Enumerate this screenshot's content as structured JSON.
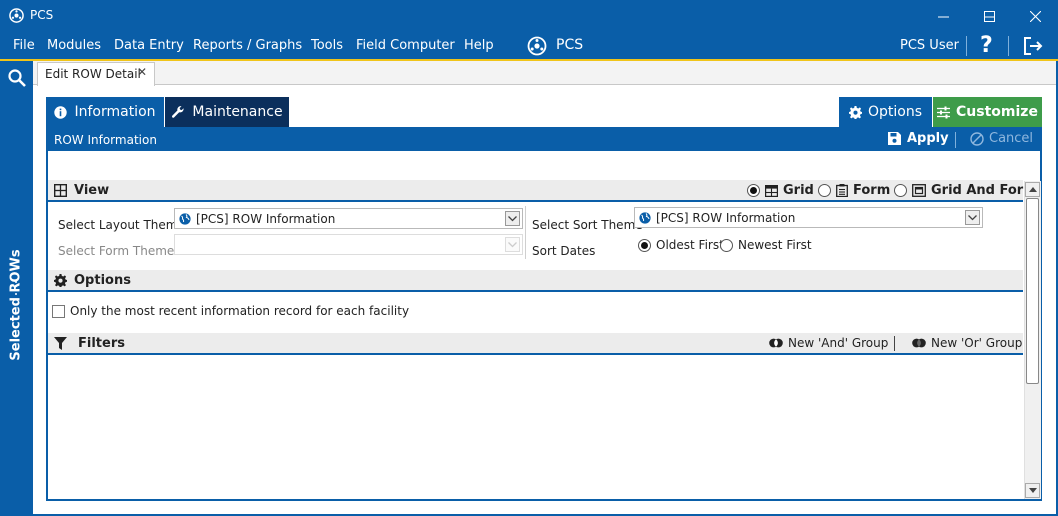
{
  "window": {
    "title": "PCS"
  },
  "menu": {
    "items": [
      "File",
      "Modules",
      "Data Entry",
      "Reports / Graphs",
      "Tools",
      "Field Computer",
      "Help"
    ],
    "brand": "PCS",
    "user": "PCS User",
    "help_glyph": "?"
  },
  "rail": {
    "label": "Selected ROWs"
  },
  "doc_tab": {
    "label": "Edit ROW Detail",
    "close_glyph": "✕"
  },
  "tabs": {
    "information": "Information",
    "maintenance": "Maintenance"
  },
  "buttons": {
    "options": "Options",
    "customize": "Customize",
    "apply": "Apply",
    "cancel": "Cancel"
  },
  "infobar": {
    "title": "ROW Information"
  },
  "view": {
    "title": "View",
    "modes": [
      "Grid",
      "Form",
      "Grid And Form"
    ],
    "selected_mode": "Grid",
    "layout_theme_label": "Select Layout Theme",
    "layout_theme_value": "[PCS] ROW Information",
    "form_theme_label": "Select Form Theme",
    "form_theme_value": "",
    "sort_theme_label": "Select Sort Theme",
    "sort_theme_value": "[PCS] ROW Information",
    "sort_dates_label": "Sort Dates",
    "sort_dates_options": [
      "Oldest First",
      "Newest First"
    ],
    "sort_dates_selected": "Oldest First"
  },
  "options": {
    "title": "Options",
    "recent_only_label": "Only the most recent information record for each facility",
    "recent_only_checked": false
  },
  "filters": {
    "title": "Filters",
    "new_and_group": "New 'And' Group",
    "new_or_group": "New 'Or' Group"
  },
  "colors": {
    "primary": "#0a5ea8",
    "dark_tab": "#0b2f5c",
    "customize_green": "#3e9c4a",
    "accent_yellow": "#f0c419"
  }
}
